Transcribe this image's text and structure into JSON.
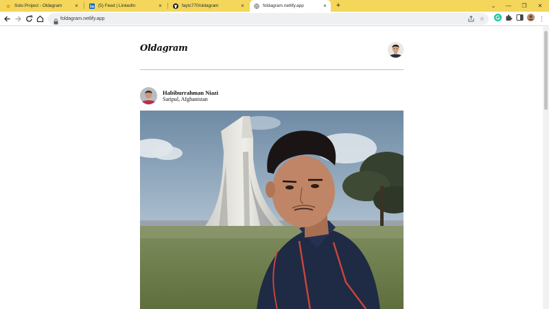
{
  "browser": {
    "tabs": [
      {
        "title": "Solo Project - Oldagram",
        "favicon": "star-icon",
        "active": false
      },
      {
        "title": "(5) Feed | LinkedIn",
        "favicon": "linkedin-icon",
        "active": false
      },
      {
        "title": "faytc770/oldagram",
        "favicon": "github-icon",
        "active": false
      },
      {
        "title": "foldagram.netlify.app",
        "favicon": "globe-icon",
        "active": true
      }
    ],
    "new_tab": "+",
    "url": "foldagram.netlify.app",
    "accent_color": "#f3d65a"
  },
  "site": {
    "logo": "Oldagram"
  },
  "post": {
    "name": "Habiburrahman Niazi",
    "location": "Saripul, Afghanistan"
  }
}
